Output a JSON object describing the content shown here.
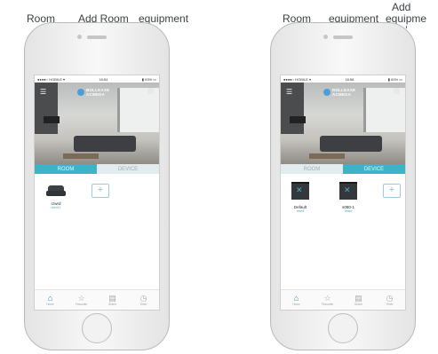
{
  "annotations": {
    "left": {
      "room": "Room",
      "add_room": "Add Room",
      "equipment": "equipment"
    },
    "right": {
      "room": "Room",
      "equipment": "equipment",
      "add_top": "Add",
      "add_bottom": "equipme"
    }
  },
  "phone_left": {
    "status_left": "●●●●○ HOBILE ▾",
    "status_time": "16:54",
    "status_right": "▮ 63% ▭",
    "brand_line1": "BOLLEASE",
    "brand_line2": "ACMEDA",
    "tabs": {
      "room": "ROOM",
      "device": "DEVICE"
    },
    "room_tile": {
      "label": "rzwrd",
      "sub": "rzwrd 1"
    },
    "plus": "+",
    "nav": [
      {
        "icon": "⌂",
        "label": "Home"
      },
      {
        "icon": "☆",
        "label": "Favourite"
      },
      {
        "icon": "▤",
        "label": "Scene"
      },
      {
        "icon": "◷",
        "label": "Timer"
      }
    ]
  },
  "phone_right": {
    "status_left": "●●●●○ HOBILE ▾",
    "status_time": "16:58",
    "status_right": "▮ 60% ▭",
    "brand_line1": "ROLLEASE",
    "brand_line2": "ACMEDA",
    "tabs": {
      "room": "ROOM",
      "device": "DEVICE"
    },
    "device_tiles": [
      {
        "label": "Default",
        "sub": "rzwrd"
      },
      {
        "label": "s080-1",
        "sub": "rzwrd"
      }
    ],
    "plus": "+",
    "nav": [
      {
        "icon": "⌂",
        "label": "Home"
      },
      {
        "icon": "☆",
        "label": "Favourite"
      },
      {
        "icon": "▤",
        "label": "Scene"
      },
      {
        "icon": "◷",
        "label": "Timer"
      }
    ]
  }
}
